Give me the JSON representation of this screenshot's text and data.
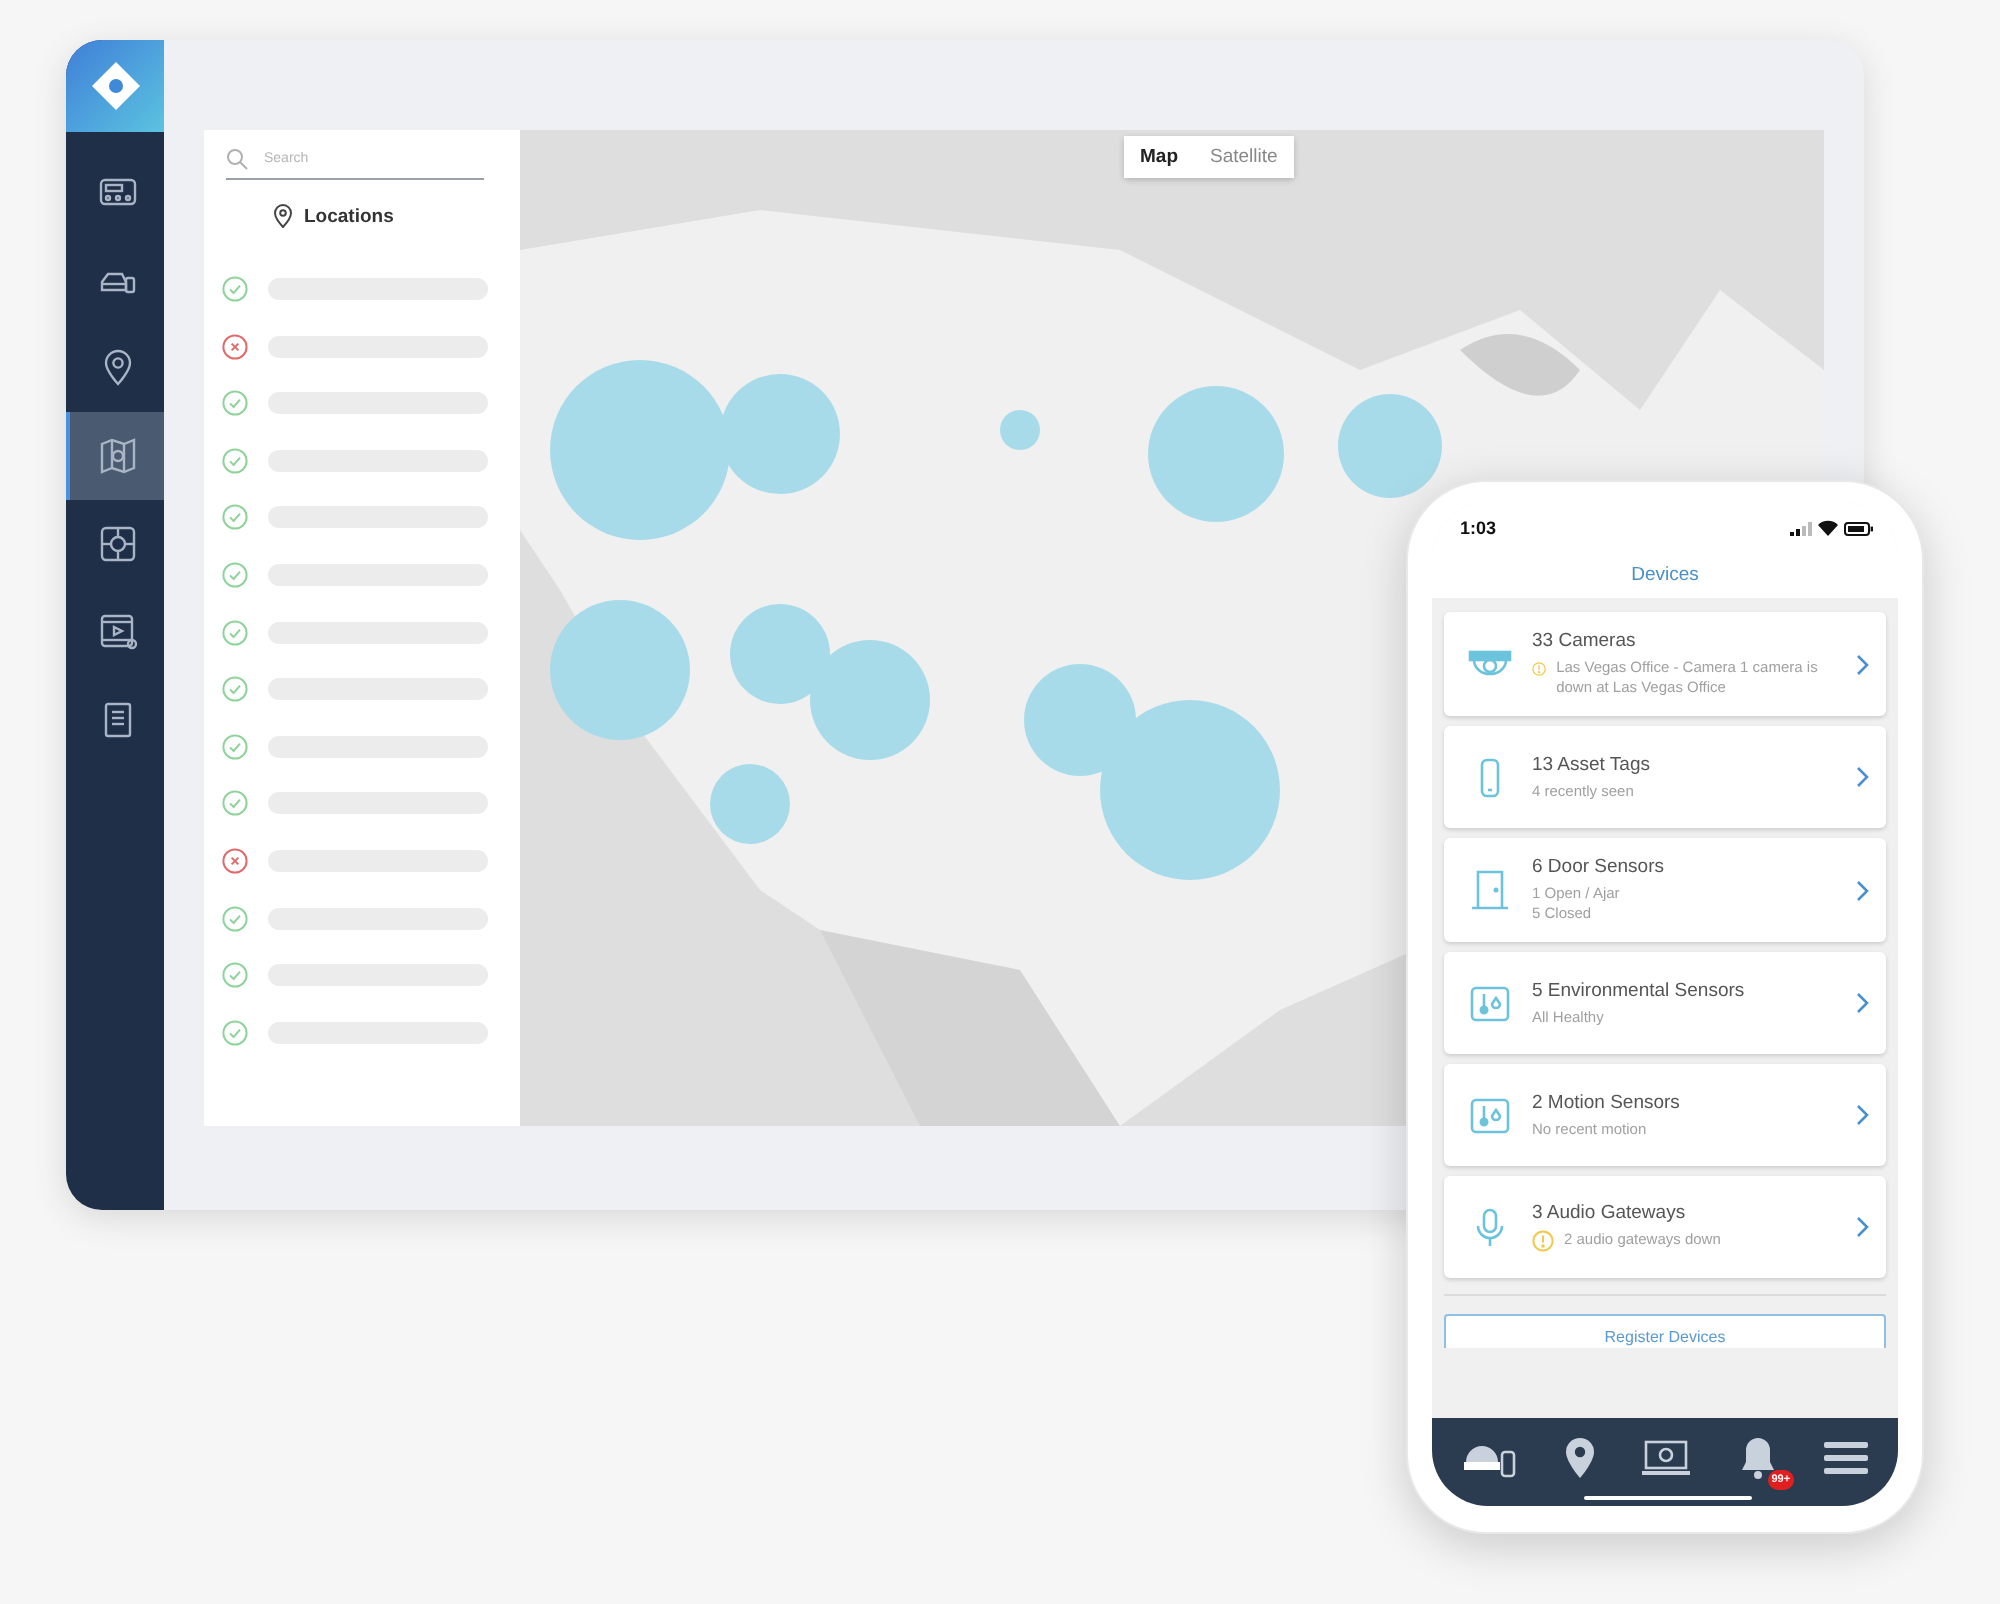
{
  "sidebar": {
    "items": [
      {
        "kind": "panel",
        "selected": false
      },
      {
        "kind": "vehicle",
        "selected": false
      },
      {
        "kind": "pin",
        "selected": false
      },
      {
        "kind": "map",
        "selected": true
      },
      {
        "kind": "target",
        "selected": false
      },
      {
        "kind": "video",
        "selected": false
      },
      {
        "kind": "document",
        "selected": false
      }
    ]
  },
  "locations_panel": {
    "search": {
      "placeholder": "Search"
    },
    "title": "Locations",
    "rows": [
      {
        "ok": true
      },
      {
        "ok": false
      },
      {
        "ok": true
      },
      {
        "ok": true
      },
      {
        "ok": true
      },
      {
        "ok": true
      },
      {
        "ok": true
      },
      {
        "ok": true
      },
      {
        "ok": true
      },
      {
        "ok": true
      },
      {
        "ok": false
      },
      {
        "ok": true
      },
      {
        "ok": true
      },
      {
        "ok": true
      }
    ]
  },
  "map": {
    "kind": "picture",
    "view_toggle": [
      {
        "label": "Map",
        "selected": true
      },
      {
        "label": "Satellite",
        "selected": false
      }
    ]
  },
  "phone": {
    "status_bar": {
      "time": "1:03"
    },
    "title": "Devices",
    "devices": [
      {
        "kind": "camera",
        "title": "33 Cameras",
        "details": [
          "Las Vegas Office - Camera 1 camera is down at Las Vegas Office"
        ],
        "warning": true
      },
      {
        "kind": "tag",
        "title": "13 Asset Tags",
        "details": [
          "4 recently seen"
        ],
        "warning": false
      },
      {
        "kind": "door",
        "title": "6 Door Sensors",
        "details": [
          "1 Open / Ajar",
          "5 Closed"
        ],
        "warning": false
      },
      {
        "kind": "environment",
        "title": "5 Environmental Sensors",
        "details": [
          "All Healthy"
        ],
        "warning": false
      },
      {
        "kind": "motion",
        "title": "2 Motion Sensors",
        "details": [
          "No recent motion"
        ],
        "warning": false
      },
      {
        "kind": "audio",
        "title": "3 Audio Gateways",
        "details": [
          "2 audio gateways down"
        ],
        "warning": true
      }
    ],
    "register_button": "Register Devices",
    "nav": [
      {
        "kind": "devices"
      },
      {
        "kind": "pin"
      },
      {
        "kind": "screen"
      },
      {
        "kind": "bell",
        "badge": "99+"
      },
      {
        "kind": "menu"
      }
    ]
  }
}
